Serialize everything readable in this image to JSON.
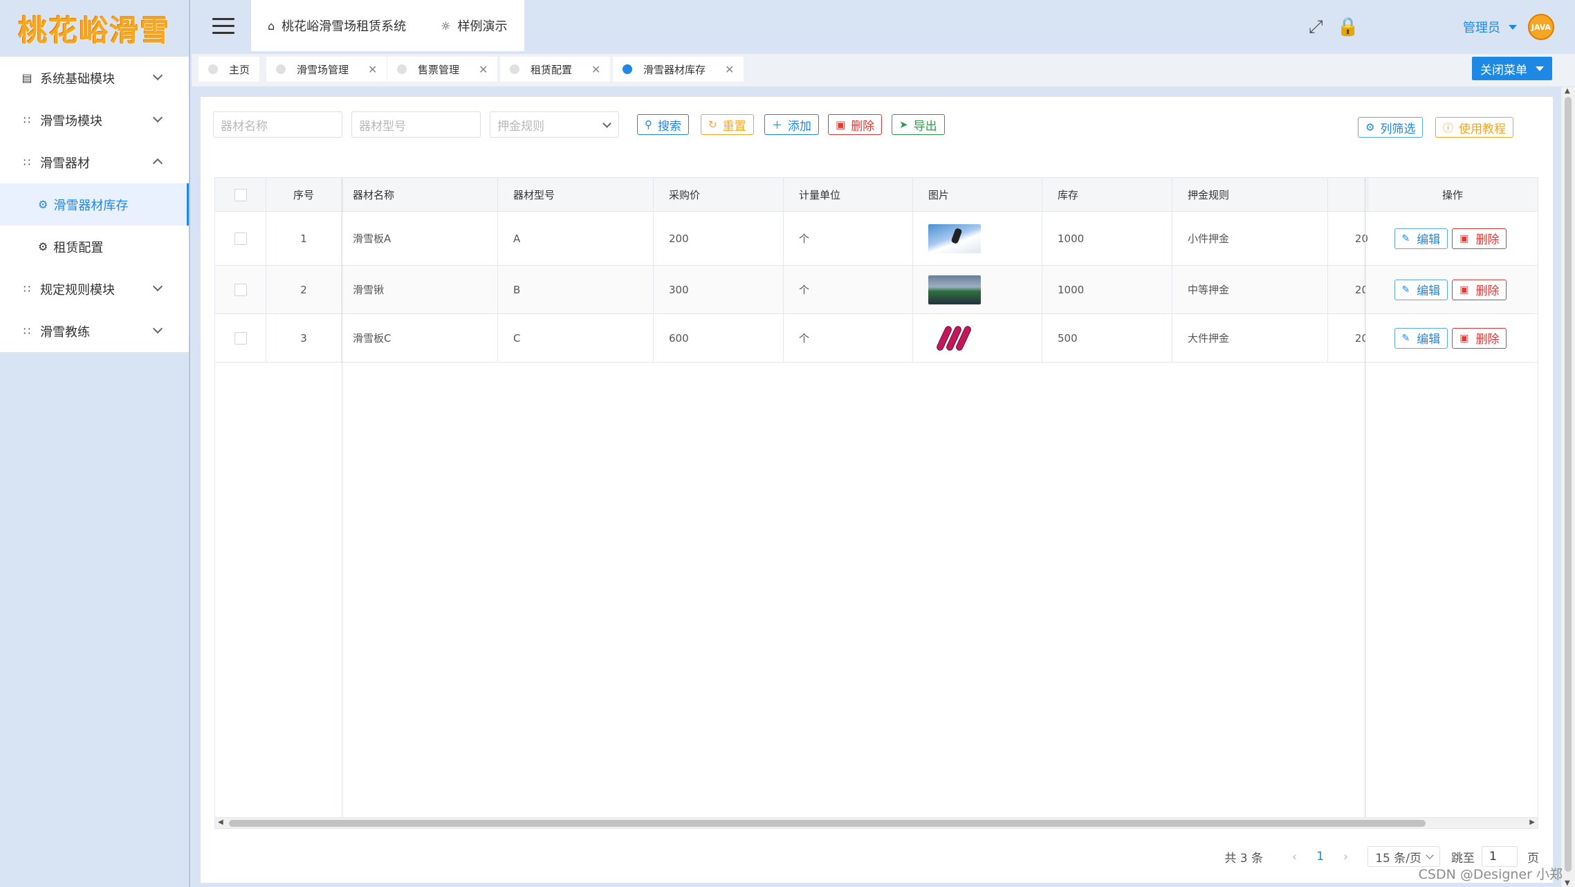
{
  "app": {
    "logo_text": "桃花峪滑雪",
    "system_title": "桃花峪滑雪场租赁系统",
    "demo_label": "样例演示"
  },
  "sidebar": {
    "items": [
      {
        "label": "系统基础模块",
        "icon": "chart-icon",
        "expanded": false
      },
      {
        "label": "滑雪场模块",
        "icon": "grid-icon",
        "expanded": false
      },
      {
        "label": "滑雪器材",
        "icon": "grid-icon",
        "expanded": true
      },
      {
        "label": "规定规则模块",
        "icon": "grid-icon",
        "expanded": false
      },
      {
        "label": "滑雪教练",
        "icon": "grid-icon",
        "expanded": false
      }
    ],
    "sub_items": [
      {
        "label": "滑雪器材库存",
        "icon": "gear-icon",
        "active": true
      },
      {
        "label": "租赁配置",
        "icon": "gear-icon",
        "active": false
      }
    ]
  },
  "header": {
    "user_name": "管理员",
    "avatar_text": "JAVA"
  },
  "tabs": {
    "items": [
      "主页",
      "滑雪场管理",
      "售票管理",
      "租赁配置",
      "滑雪器材库存"
    ],
    "close_menu_label": "关闭菜单"
  },
  "filters": {
    "name_placeholder": "器材名称",
    "model_placeholder": "器材型号",
    "deposit_placeholder": "押金规则"
  },
  "toolbar": {
    "search": "搜索",
    "reset": "重置",
    "add": "添加",
    "delete": "删除",
    "export": "导出",
    "column_filter": "列筛选",
    "tutorial": "使用教程"
  },
  "table": {
    "columns": [
      "序号",
      "器材名称",
      "器材型号",
      "采购价",
      "计量单位",
      "图片",
      "库存",
      "押金规则",
      "操作"
    ],
    "rows": [
      {
        "index": "1",
        "name": "滑雪板A",
        "model": "A",
        "price": "200",
        "unit": "个",
        "stock": "1000",
        "deposit": "小件押金",
        "extra": "20"
      },
      {
        "index": "2",
        "name": "滑雪锹",
        "model": "B",
        "price": "300",
        "unit": "个",
        "stock": "1000",
        "deposit": "中等押金",
        "extra": "20"
      },
      {
        "index": "3",
        "name": "滑雪板C",
        "model": "C",
        "price": "600",
        "unit": "个",
        "stock": "500",
        "deposit": "大件押金",
        "extra": "20"
      }
    ],
    "edit_label": "编辑",
    "delete_label": "删除"
  },
  "pagination": {
    "total_text": "共 3 条",
    "current_page": "1",
    "page_size": "15 条/页",
    "jump_label": "跳至",
    "jump_value": "1",
    "page_suffix": "页"
  },
  "watermark": "CSDN @Designer 小郑",
  "colors": {
    "primary": "#1e88e5",
    "warning": "#f5a623",
    "danger": "#e53935",
    "success": "#2e9d4b",
    "sidebar_bg": "#d8e3f3"
  }
}
